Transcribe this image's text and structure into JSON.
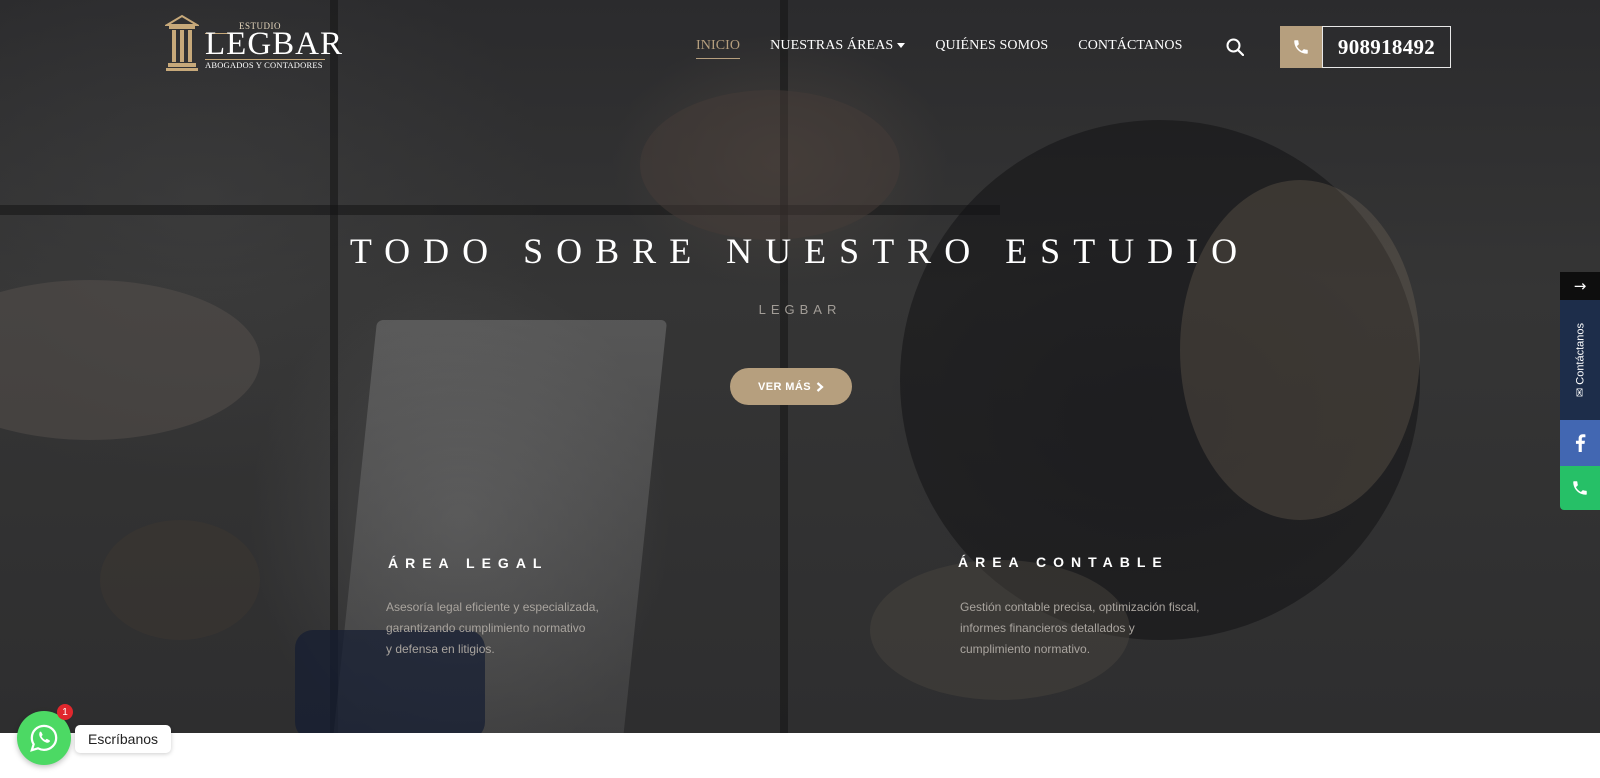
{
  "logo": {
    "top_text": "ESTUDIO",
    "name": "LEGBAR",
    "subtitle": "ABOGADOS Y CONTADORES",
    "emblem": "pillar-logo-icon"
  },
  "nav": {
    "items": [
      {
        "label": "INICIO",
        "active": true
      },
      {
        "label": "NUESTRAS ÁREAS",
        "has_dropdown": true
      },
      {
        "label": "QUIÉNES SOMOS"
      },
      {
        "label": "CONTÁCTANOS"
      }
    ],
    "search_icon": "search-icon"
  },
  "header_phone": {
    "number": "908918492",
    "icon": "phone-icon"
  },
  "hero": {
    "title": "TODO SOBRE NUESTRO ESTUDIO",
    "subtitle": "LEGBAR",
    "cta_label": "VER MÁS",
    "cta_icon": "chevron-right-icon"
  },
  "areas": [
    {
      "title": "ÁREA LEGAL",
      "lines": [
        "Asesoría legal eficiente y especializada,",
        "garantizando cumplimiento normativo",
        "y defensa en litigios."
      ]
    },
    {
      "title": "ÁREA CONTABLE",
      "lines": [
        "Gestión contable precisa, optimización fiscal,",
        "informes financieros detallados y",
        "cumplimiento normativo."
      ]
    }
  ],
  "side_widget": {
    "arrow": "→",
    "contact_label": "Contáctanos",
    "icons": [
      "mail-icon",
      "facebook-icon",
      "phone-icon"
    ]
  },
  "whatsapp": {
    "badge": "1",
    "label": "Escríbanos",
    "icon": "whatsapp-icon"
  },
  "colors": {
    "accent": "#b69f7e",
    "facebook": "#4267b2",
    "phone_green": "#26c067",
    "whatsapp": "#4cd964",
    "contact_navy": "#1d2d4a"
  }
}
